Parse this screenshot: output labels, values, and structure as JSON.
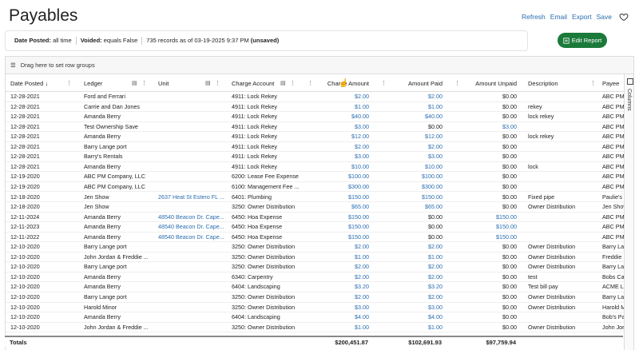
{
  "page": {
    "title": "Payables"
  },
  "actions": {
    "refresh": "Refresh",
    "email": "Email",
    "export": "Export",
    "save": "Save"
  },
  "filters": {
    "date_label": "Date Posted:",
    "date_value": "all time",
    "voided_label": "Voided:",
    "voided_value": "equals False",
    "records": "735 records as of 03-19-2025 9:37 PM",
    "unsaved": "(unsaved)"
  },
  "edit_button": "Edit Report",
  "group_bar": "Drag here to set row groups",
  "side_panel": "Columns",
  "columns": {
    "date": "Date Posted",
    "ledger": "Ledger",
    "unit": "Unit",
    "charge_account": "Charge Account",
    "charge_amount": "Charge Amount",
    "amount_paid": "Amount Paid",
    "amount_unpaid": "Amount Unpaid",
    "description": "Description",
    "payee": "Payee"
  },
  "rows": [
    {
      "date": "12-28-2021",
      "ledger": "Ford and Ferrari",
      "unit": "",
      "account": "4911: Lock Rekey",
      "charge": "$2.00",
      "paid": "$2.00",
      "unpaid": "$0.00",
      "desc": "",
      "payee": "ABC PM"
    },
    {
      "date": "12-28-2021",
      "ledger": "Carrie and Dan Jones",
      "unit": "",
      "account": "4911: Lock Rekey",
      "charge": "$1.00",
      "paid": "$1.00",
      "unpaid": "$0.00",
      "desc": "rekey",
      "payee": "ABC PM"
    },
    {
      "date": "12-28-2021",
      "ledger": "Amanda Berry",
      "unit": "",
      "account": "4911: Lock Rekey",
      "charge": "$40.00",
      "paid": "$40.00",
      "unpaid": "$0.00",
      "desc": "lock rekey",
      "payee": "ABC PM"
    },
    {
      "date": "12-28-2021",
      "ledger": "Test Ownership Save",
      "unit": "",
      "account": "4911: Lock Rekey",
      "charge": "$3.00",
      "paid": "$0.00",
      "unpaid": "$3.00",
      "desc": "",
      "payee": "ABC PM"
    },
    {
      "date": "12-28-2021",
      "ledger": "Amanda Berry",
      "unit": "",
      "account": "4911: Lock Rekey",
      "charge": "$12.00",
      "paid": "$12.00",
      "unpaid": "$0.00",
      "desc": "lock rekey",
      "payee": "ABC PM"
    },
    {
      "date": "12-28-2021",
      "ledger": "Barry Lange port",
      "unit": "",
      "account": "4911: Lock Rekey",
      "charge": "$2.00",
      "paid": "$2.00",
      "unpaid": "$0.00",
      "desc": "",
      "payee": "ABC PM"
    },
    {
      "date": "12-28-2021",
      "ledger": "Barry's Rentals",
      "unit": "",
      "account": "4911: Lock Rekey",
      "charge": "$3.00",
      "paid": "$3.00",
      "unpaid": "$0.00",
      "desc": "",
      "payee": "ABC PM"
    },
    {
      "date": "12-28-2021",
      "ledger": "Amanda Berry",
      "unit": "",
      "account": "4911: Lock Rekey",
      "charge": "$10.00",
      "paid": "$10.00",
      "unpaid": "$0.00",
      "desc": "lock",
      "payee": "ABC PM"
    },
    {
      "date": "12-19-2020",
      "ledger": "ABC PM Company, LLC",
      "unit": "",
      "account": "6200: Lease Fee Expense",
      "charge": "$100.00",
      "paid": "$100.00",
      "unpaid": "$0.00",
      "desc": "",
      "payee": "ABC PM"
    },
    {
      "date": "12-19-2020",
      "ledger": "ABC PM Company, LLC",
      "unit": "",
      "account": "6100: Management Fee ...",
      "charge": "$300.00",
      "paid": "$300.00",
      "unpaid": "$0.00",
      "desc": "",
      "payee": "ABC PM"
    },
    {
      "date": "12-18-2020",
      "ledger": "Jen Show",
      "unit": "2637 Heat St Estero FL ...",
      "account": "6401: Plumbing",
      "charge": "$150.00",
      "paid": "$150.00",
      "unpaid": "$0.00",
      "desc": "Fixed pipe",
      "payee": "Paulie's"
    },
    {
      "date": "12-18-2020",
      "ledger": "Jen Show",
      "unit": "",
      "account": "3250: Owner Distribution",
      "charge": "$65.00",
      "paid": "$65.00",
      "unpaid": "$0.00",
      "desc": "Owner Distribution",
      "payee": "Jen Show"
    },
    {
      "date": "12-11-2024",
      "ledger": "Amanda Berry",
      "unit": "48540 Beacon Dr. Cape...",
      "account": "6450: Hoa Expense",
      "charge": "$150.00",
      "paid": "$0.00",
      "unpaid": "$150.00",
      "desc": "",
      "payee": "ABC PM"
    },
    {
      "date": "12-11-2023",
      "ledger": "Amanda Berry",
      "unit": "48540 Beacon Dr. Cape...",
      "account": "6450: Hoa Expense",
      "charge": "$150.00",
      "paid": "$0.00",
      "unpaid": "$150.00",
      "desc": "",
      "payee": "ABC PM"
    },
    {
      "date": "12-11-2022",
      "ledger": "Amanda Berry",
      "unit": "48540 Beacon Dr. Cape...",
      "account": "6450: Hoa Expense",
      "charge": "$150.00",
      "paid": "$0.00",
      "unpaid": "$150.00",
      "desc": "",
      "payee": "ABC PM"
    },
    {
      "date": "12-10-2020",
      "ledger": "Barry Lange port",
      "unit": "",
      "account": "3250: Owner Distribution",
      "charge": "$2.00",
      "paid": "$2.00",
      "unpaid": "$0.00",
      "desc": "Owner Distribution",
      "payee": "Barry La"
    },
    {
      "date": "12-10-2020",
      "ledger": "John Jordan & Freddie ...",
      "unit": "",
      "account": "3250: Owner Distribution",
      "charge": "$1.00",
      "paid": "$1.00",
      "unpaid": "$0.00",
      "desc": "Owner Distribution",
      "payee": "Freddie"
    },
    {
      "date": "12-10-2020",
      "ledger": "Barry Lange port",
      "unit": "",
      "account": "3250: Owner Distribution",
      "charge": "$2.00",
      "paid": "$2.00",
      "unpaid": "$0.00",
      "desc": "Owner Distribution",
      "payee": "Barry La"
    },
    {
      "date": "12-10-2020",
      "ledger": "Amanda Berry",
      "unit": "",
      "account": "6340: Carpentry",
      "charge": "$2.00",
      "paid": "$2.00",
      "unpaid": "$0.00",
      "desc": "test",
      "payee": "Bobs Ca"
    },
    {
      "date": "12-10-2020",
      "ledger": "Amanda Berry",
      "unit": "",
      "account": "6404: Landscaping",
      "charge": "$3.20",
      "paid": "$3.20",
      "unpaid": "$0.00",
      "desc": "Test bill pay",
      "payee": "ACME La"
    },
    {
      "date": "12-10-2020",
      "ledger": "Barry Lange port",
      "unit": "",
      "account": "3250: Owner Distribution",
      "charge": "$2.00",
      "paid": "$2.00",
      "unpaid": "$0.00",
      "desc": "Owner Distribution",
      "payee": "Barry La"
    },
    {
      "date": "12-10-2020",
      "ledger": "Harold Minor",
      "unit": "",
      "account": "3250: Owner Distribution",
      "charge": "$3.00",
      "paid": "$3.00",
      "unpaid": "$0.00",
      "desc": "Owner Distribution",
      "payee": "Harold M"
    },
    {
      "date": "12-10-2020",
      "ledger": "Amanda Berry",
      "unit": "",
      "account": "6404: Landscaping",
      "charge": "$4.00",
      "paid": "$4.00",
      "unpaid": "$0.00",
      "desc": "",
      "payee": "Bob's Pa"
    },
    {
      "date": "12-10-2020",
      "ledger": "John Jordan & Freddie ...",
      "unit": "",
      "account": "3250: Owner Distribution",
      "charge": "$1.00",
      "paid": "$1.00",
      "unpaid": "$0.00",
      "desc": "Owner Distribution",
      "payee": "John Jor"
    }
  ],
  "totals": {
    "label": "Totals",
    "charge": "$200,451.87",
    "paid": "$102,691.93",
    "unpaid": "$97,759.94"
  },
  "colors": {
    "accent": "#2a6db0",
    "button": "#1b7a3a"
  }
}
